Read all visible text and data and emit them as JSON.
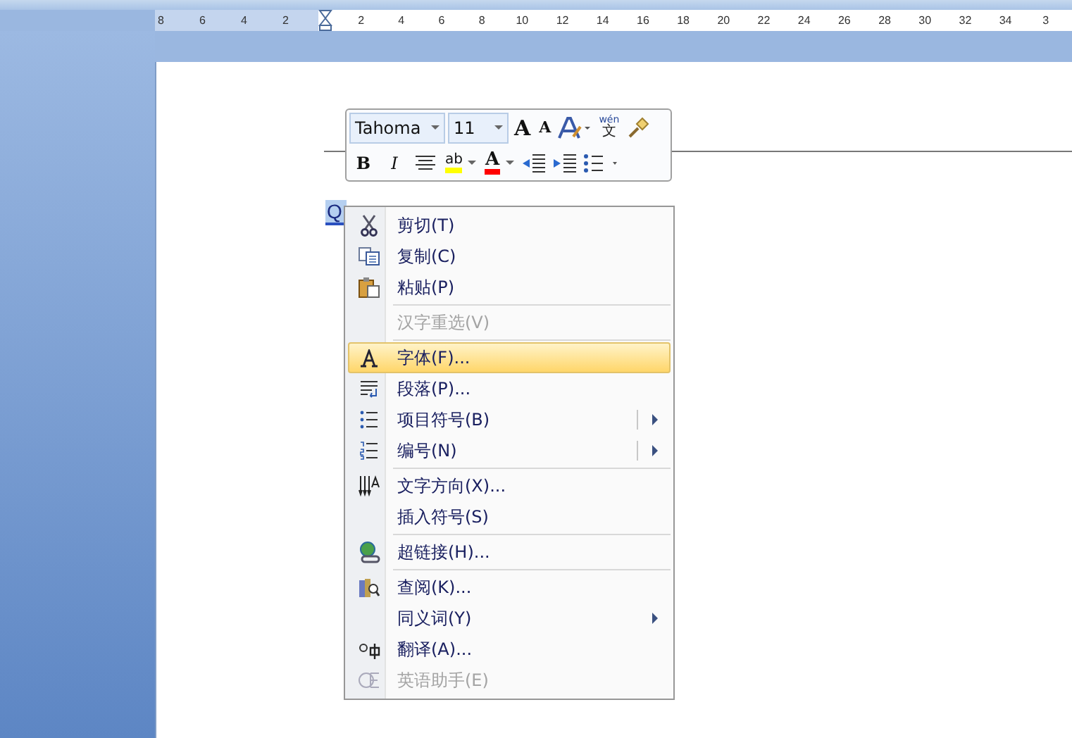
{
  "ruler": {
    "left_labels": [
      "8",
      "6",
      "4",
      "2"
    ],
    "right_labels": [
      "2",
      "4",
      "6",
      "8",
      "10",
      "12",
      "14",
      "16",
      "18",
      "20",
      "22",
      "24",
      "26",
      "28",
      "30",
      "32",
      "34",
      "3"
    ]
  },
  "document": {
    "selected_text": "Q"
  },
  "mini_toolbar": {
    "font": "Tahoma",
    "size": "11",
    "row_1": [
      {
        "kind": "grow",
        "text": "A"
      },
      {
        "kind": "shrink",
        "text": "A"
      },
      {
        "kind": "styles"
      },
      {
        "kind": "phonetic",
        "text": "wén",
        "sub": "文"
      },
      {
        "kind": "painter"
      }
    ],
    "row_2": [
      {
        "kind": "bold",
        "text": "B"
      },
      {
        "kind": "italic",
        "text": "I"
      },
      {
        "kind": "center"
      },
      {
        "kind": "highlight",
        "text": "ab",
        "color": "#ffff00"
      },
      {
        "kind": "fontcolor",
        "text": "A",
        "color": "#ff0000"
      },
      {
        "kind": "outdent"
      },
      {
        "kind": "indent"
      },
      {
        "kind": "bullets"
      }
    ]
  },
  "context_menu": [
    {
      "kind": "item",
      "text": "剪切(T)",
      "disabled": false,
      "selected": false,
      "submenu": false,
      "split": false
    },
    {
      "kind": "item",
      "text": "复制(C)",
      "disabled": false,
      "selected": false,
      "submenu": false,
      "split": false
    },
    {
      "kind": "item",
      "text": "粘贴(P)",
      "disabled": false,
      "selected": false,
      "submenu": false,
      "split": false
    },
    {
      "kind": "separator"
    },
    {
      "kind": "item",
      "text": "汉字重选(V)",
      "disabled": true,
      "selected": false,
      "submenu": false,
      "split": false
    },
    {
      "kind": "separator"
    },
    {
      "kind": "item",
      "text": "字体(F)...",
      "disabled": false,
      "selected": true,
      "submenu": false,
      "split": false
    },
    {
      "kind": "item",
      "text": "段落(P)...",
      "disabled": false,
      "selected": false,
      "submenu": false,
      "split": false
    },
    {
      "kind": "item",
      "text": "项目符号(B)",
      "disabled": false,
      "selected": false,
      "submenu": true,
      "split": true
    },
    {
      "kind": "item",
      "text": "编号(N)",
      "disabled": false,
      "selected": false,
      "submenu": true,
      "split": true
    },
    {
      "kind": "separator"
    },
    {
      "kind": "item",
      "text": "文字方向(X)...",
      "disabled": false,
      "selected": false,
      "submenu": false,
      "split": false
    },
    {
      "kind": "item",
      "text": "插入符号(S)",
      "disabled": false,
      "selected": false,
      "submenu": false,
      "split": false
    },
    {
      "kind": "separator"
    },
    {
      "kind": "item",
      "text": "超链接(H)...",
      "disabled": false,
      "selected": false,
      "submenu": false,
      "split": false
    },
    {
      "kind": "separator"
    },
    {
      "kind": "item",
      "text": "查阅(K)...",
      "disabled": false,
      "selected": false,
      "submenu": false,
      "split": false
    },
    {
      "kind": "item",
      "text": "同义词(Y)",
      "disabled": false,
      "selected": false,
      "submenu": true,
      "split": false
    },
    {
      "kind": "item",
      "text": "翻译(A)...",
      "disabled": false,
      "selected": false,
      "submenu": false,
      "split": false
    },
    {
      "kind": "item",
      "text": "英语助手(E)",
      "disabled": true,
      "selected": false,
      "submenu": false,
      "split": false
    }
  ]
}
